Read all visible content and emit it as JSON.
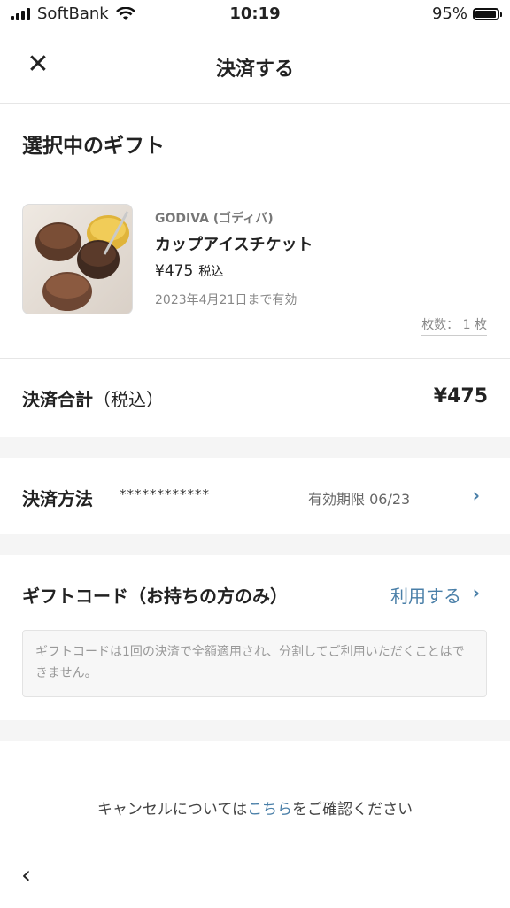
{
  "status_bar": {
    "carrier": "SoftBank",
    "time": "10:19",
    "battery": "95%"
  },
  "header": {
    "title": "決済する",
    "close_icon": "close-icon"
  },
  "selected_gift": {
    "section_title": "選択中のギフト",
    "brand": "GODIVA (ゴディバ)",
    "name": "カップアイスチケット",
    "price": "¥475",
    "tax_label": "税込",
    "validity": "2023年4月21日まで有効",
    "quantity": "枚数： 1 枚"
  },
  "total": {
    "label": "決済合計",
    "label_suffix": "（税込）",
    "value": "¥475"
  },
  "payment": {
    "label": "決済方法",
    "card_number": "************",
    "expiry": "有効期限 06/23"
  },
  "gift_code": {
    "label": "ギフトコード（お持ちの方のみ）",
    "use_link": "利用する",
    "note": "ギフトコードは1回の決済で全額適用され、分割してご利用いただくことはできません。"
  },
  "cancel": {
    "prefix": "キャンセルについては",
    "link": "こちら",
    "suffix": "をご確認ください"
  },
  "colors": {
    "accent": "#4a7fa8",
    "divider": "#e6e6e6",
    "gap": "#f5f5f5"
  }
}
